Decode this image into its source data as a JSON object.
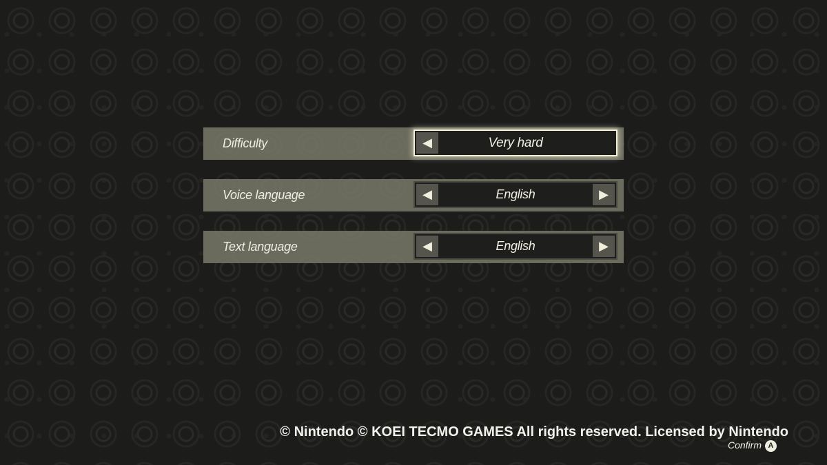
{
  "settings": [
    {
      "label": "Difficulty",
      "value": "Very hard",
      "focused": true,
      "left_arrow": true,
      "right_arrow": false
    },
    {
      "label": "Voice language",
      "value": "English",
      "focused": false,
      "left_arrow": true,
      "right_arrow": true
    },
    {
      "label": "Text language",
      "value": "English",
      "focused": false,
      "left_arrow": true,
      "right_arrow": true
    }
  ],
  "footer": {
    "copyright": "© Nintendo © KOEI TECMO GAMES All rights reserved. Licensed by Nintendo",
    "confirm_label": "Confirm",
    "confirm_button": "A"
  }
}
